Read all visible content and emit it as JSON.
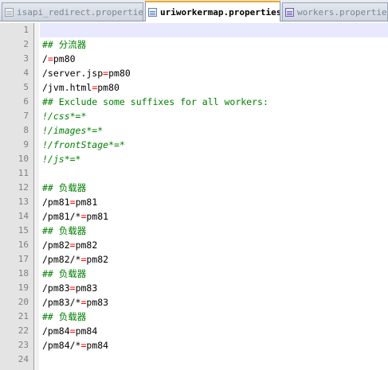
{
  "tabs": [
    {
      "label": "isapi_redirect.properties",
      "active": false,
      "icon": "gray"
    },
    {
      "label": "uriworkermap.properties",
      "active": true,
      "icon": "blue"
    },
    {
      "label": "workers.properties",
      "active": false,
      "icon": "purple"
    }
  ],
  "editor": {
    "current_line": 1,
    "lines": [
      {
        "n": "1",
        "type": "blank",
        "segments": []
      },
      {
        "n": "2",
        "type": "comment",
        "segments": [
          {
            "t": "## 分流器",
            "k": "txt"
          }
        ]
      },
      {
        "n": "3",
        "type": "code",
        "segments": [
          {
            "t": "/",
            "k": "txt"
          },
          {
            "t": "=",
            "k": "eq"
          },
          {
            "t": "pm80",
            "k": "txt"
          }
        ]
      },
      {
        "n": "4",
        "type": "code",
        "segments": [
          {
            "t": "/server.jsp",
            "k": "txt"
          },
          {
            "t": "=",
            "k": "eq"
          },
          {
            "t": "pm80",
            "k": "txt"
          }
        ]
      },
      {
        "n": "5",
        "type": "code",
        "segments": [
          {
            "t": "/jvm.html",
            "k": "txt"
          },
          {
            "t": "=",
            "k": "eq"
          },
          {
            "t": "pm80",
            "k": "txt"
          }
        ]
      },
      {
        "n": "6",
        "type": "comment",
        "segments": [
          {
            "t": "## Exclude some suffixes for all workers:",
            "k": "txt"
          }
        ]
      },
      {
        "n": "7",
        "type": "exclude",
        "segments": [
          {
            "t": "!/css*=*",
            "k": "txt"
          }
        ]
      },
      {
        "n": "8",
        "type": "exclude",
        "segments": [
          {
            "t": "!/images*=*",
            "k": "txt"
          }
        ]
      },
      {
        "n": "9",
        "type": "exclude",
        "segments": [
          {
            "t": "!/frontStage*=*",
            "k": "txt"
          }
        ]
      },
      {
        "n": "10",
        "type": "exclude",
        "segments": [
          {
            "t": "!/js*=*",
            "k": "txt"
          }
        ]
      },
      {
        "n": "11",
        "type": "blank",
        "segments": []
      },
      {
        "n": "12",
        "type": "comment",
        "segments": [
          {
            "t": "## 负载器",
            "k": "txt"
          }
        ]
      },
      {
        "n": "13",
        "type": "code",
        "segments": [
          {
            "t": "/pm81",
            "k": "txt"
          },
          {
            "t": "=",
            "k": "eq"
          },
          {
            "t": "pm81",
            "k": "txt"
          }
        ]
      },
      {
        "n": "14",
        "type": "code",
        "segments": [
          {
            "t": "/pm81/*",
            "k": "txt"
          },
          {
            "t": "=",
            "k": "eq"
          },
          {
            "t": "pm81",
            "k": "txt"
          }
        ]
      },
      {
        "n": "15",
        "type": "comment",
        "segments": [
          {
            "t": "## 负载器",
            "k": "txt"
          }
        ]
      },
      {
        "n": "16",
        "type": "code",
        "segments": [
          {
            "t": "/pm82",
            "k": "txt"
          },
          {
            "t": "=",
            "k": "eq"
          },
          {
            "t": "pm82",
            "k": "txt"
          }
        ]
      },
      {
        "n": "17",
        "type": "code",
        "segments": [
          {
            "t": "/pm82/*",
            "k": "txt"
          },
          {
            "t": "=",
            "k": "eq"
          },
          {
            "t": "pm82",
            "k": "txt"
          }
        ]
      },
      {
        "n": "18",
        "type": "comment",
        "segments": [
          {
            "t": "## 负载器",
            "k": "txt"
          }
        ]
      },
      {
        "n": "19",
        "type": "code",
        "segments": [
          {
            "t": "/pm83",
            "k": "txt"
          },
          {
            "t": "=",
            "k": "eq"
          },
          {
            "t": "pm83",
            "k": "txt"
          }
        ]
      },
      {
        "n": "20",
        "type": "code",
        "segments": [
          {
            "t": "/pm83/*",
            "k": "txt"
          },
          {
            "t": "=",
            "k": "eq"
          },
          {
            "t": "pm83",
            "k": "txt"
          }
        ]
      },
      {
        "n": "21",
        "type": "comment",
        "segments": [
          {
            "t": "## 负载器",
            "k": "txt"
          }
        ]
      },
      {
        "n": "22",
        "type": "code",
        "segments": [
          {
            "t": "/pm84",
            "k": "txt"
          },
          {
            "t": "=",
            "k": "eq"
          },
          {
            "t": "pm84",
            "k": "txt"
          }
        ]
      },
      {
        "n": "23",
        "type": "code",
        "segments": [
          {
            "t": "/pm84/*",
            "k": "txt"
          },
          {
            "t": "=",
            "k": "eq"
          },
          {
            "t": "pm84",
            "k": "txt"
          }
        ]
      },
      {
        "n": "24",
        "type": "blank",
        "segments": []
      }
    ]
  }
}
